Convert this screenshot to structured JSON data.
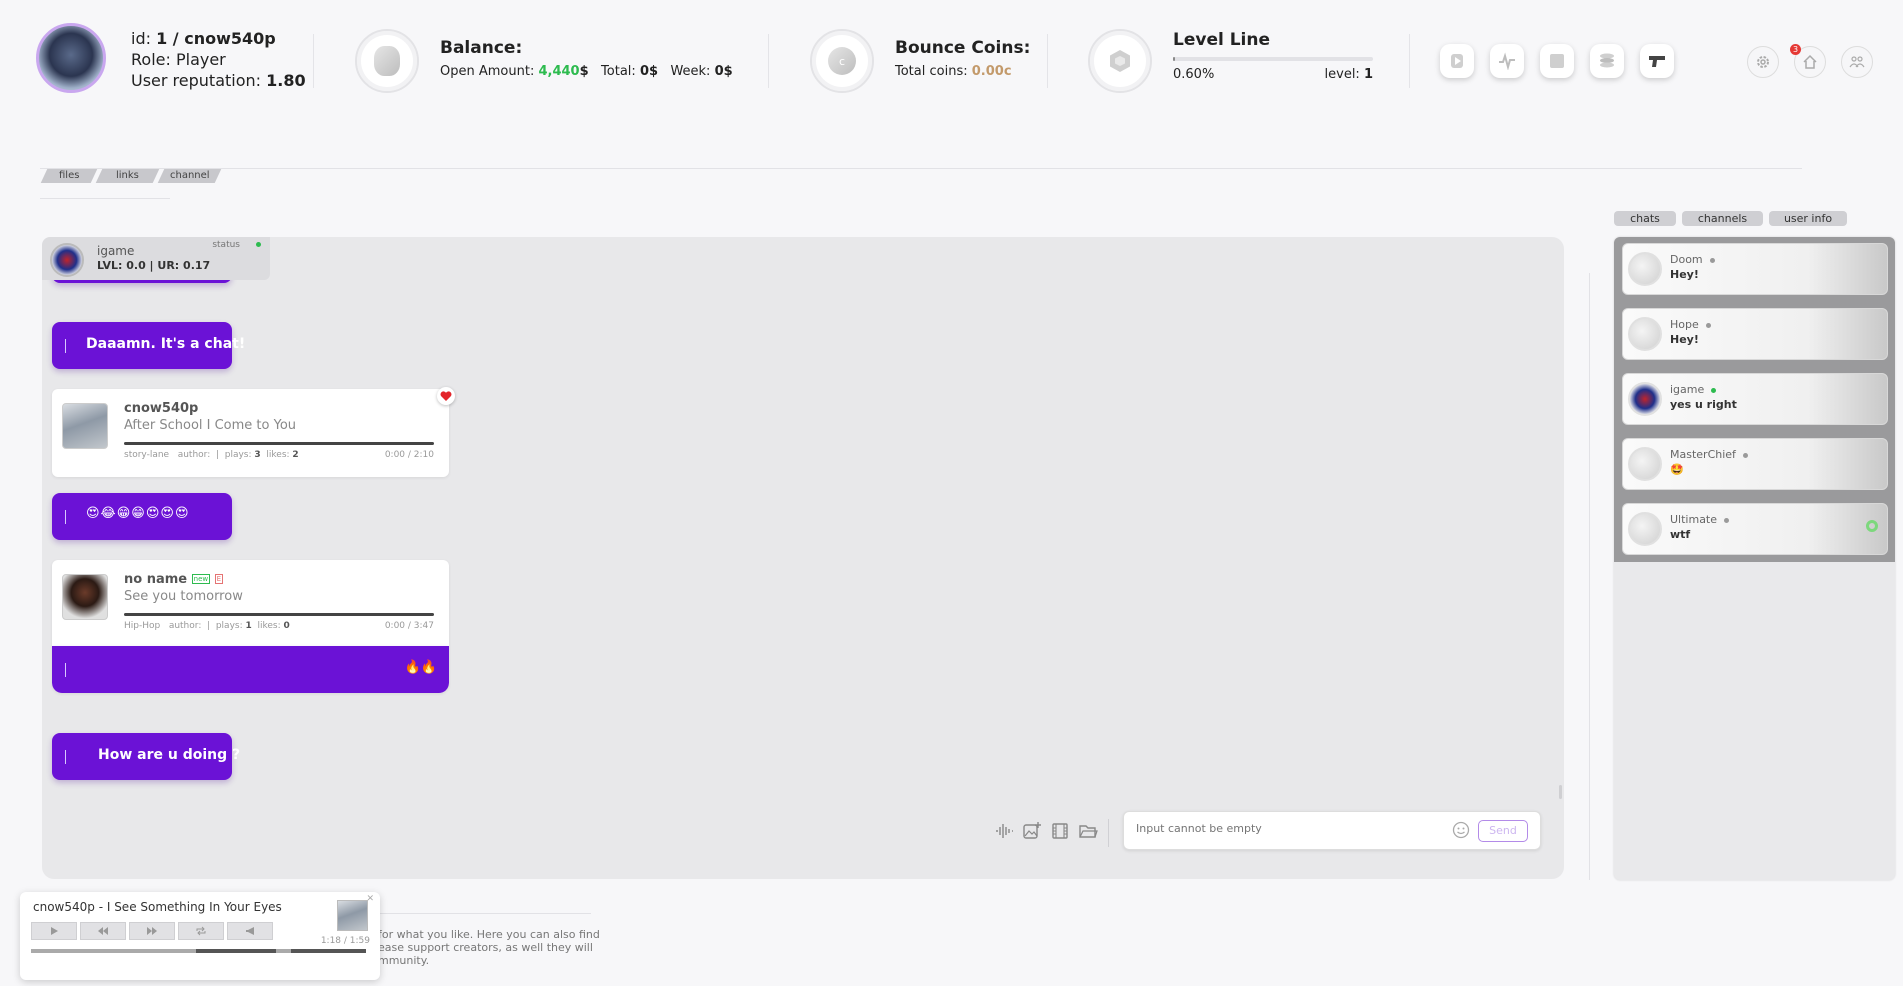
{
  "user": {
    "id_label": "id:",
    "id_value": "1 / cnow540p",
    "role_label": "Role:",
    "role_value": "Player",
    "reputation_label": "User reputation:",
    "reputation_value": "1.80"
  },
  "balance": {
    "title": "Balance:",
    "open_label": "Open Amount:",
    "open_value": "4,440",
    "open_currency": "$",
    "total_label": "Total:",
    "total_value": "0$",
    "week_label": "Week:",
    "week_value": "0$"
  },
  "bounce": {
    "title": "Bounce Coins:",
    "total_label": "Total coins:",
    "total_value": "0.00c",
    "coin_letter": "c"
  },
  "level": {
    "title": "Level Line",
    "percent_label": "0.60%",
    "progress": 0.006,
    "level_label": "level:",
    "level_value": "1"
  },
  "header_controls": [
    "play-icon",
    "pulse-icon",
    "stop-icon",
    "coins-stack-icon",
    "gun-icon"
  ],
  "right_controls": [
    "gear-icon",
    "home-icon",
    "users-icon"
  ],
  "notification_count": "3",
  "tabs": [
    "files",
    "links",
    "channel"
  ],
  "chat_user": {
    "name": "igame",
    "stats": "LVL: 0.0 | UR: 0.17",
    "status_label": "status"
  },
  "messages": {
    "m1": "Daaamn. It's a chat!",
    "m2": "😍😂😁😁😍😍😍",
    "m3": "🔥🔥",
    "m4": "How are u doing ?"
  },
  "track1": {
    "artist": "cnow540p",
    "title": "After School I Come to You",
    "genre": "story-lane",
    "author_label": "author:",
    "plays_label": "plays:",
    "plays": "3",
    "likes_label": "likes:",
    "likes": "2",
    "time": "0:00 / 2:10"
  },
  "track2": {
    "artist": "no name",
    "badge_new": "new",
    "badge_e": "E",
    "title": "See you tomorrow",
    "genre": "Hip-Hop",
    "author_label": "author:",
    "plays_label": "plays:",
    "plays": "1",
    "likes_label": "likes:",
    "likes": "0",
    "time": "0:00 / 3:47"
  },
  "input": {
    "placeholder": "Input cannot be empty",
    "send_label": "Send"
  },
  "right_tabs": [
    "chats",
    "channels",
    "user info"
  ],
  "contacts": [
    {
      "name": "Doom",
      "message": "Hey!",
      "online": false
    },
    {
      "name": "Hope",
      "message": "Hey!",
      "online": false
    },
    {
      "name": "igame",
      "message": "yes u right",
      "online": true
    },
    {
      "name": "MasterChief",
      "message": "🤩",
      "online": false
    },
    {
      "name": "Ultimate",
      "message": "wtf",
      "online": false
    }
  ],
  "player": {
    "title": "cnow540p - I See Something In Your Eyes",
    "time": "1:18 / 1:59"
  },
  "footer_text": {
    "line1": "for what you like. Here you can also find",
    "line2": "ease support creators, as well they will",
    "line3": "mmunity."
  },
  "colors": {
    "accent_purple": "#6b12d6",
    "money_green": "#2dbb4f",
    "coins_tan": "#c39a6b"
  }
}
